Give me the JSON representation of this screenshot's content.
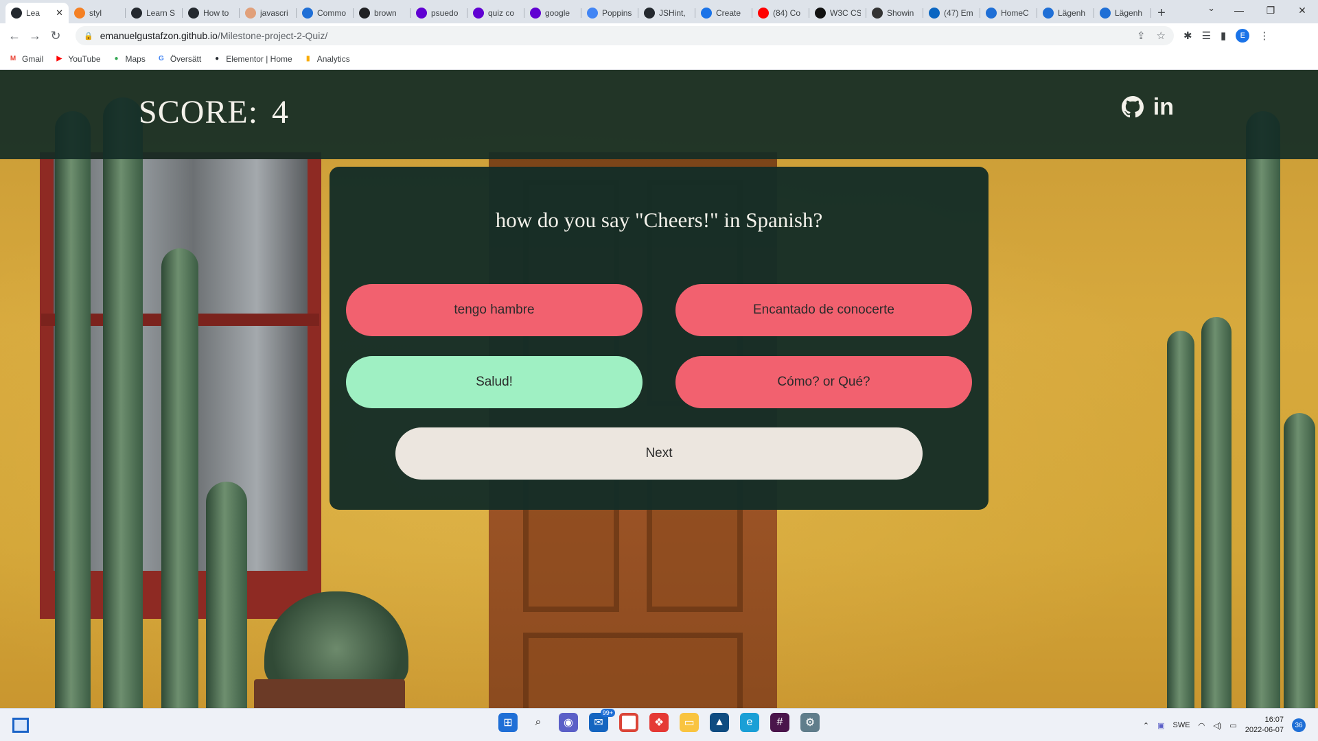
{
  "browser": {
    "tabs": [
      {
        "label": "Lea",
        "icon": "github-icon",
        "color": "#24292f",
        "active": true
      },
      {
        "label": "styl",
        "icon": "stackoverflow-icon",
        "color": "#f48024"
      },
      {
        "label": "Learn S",
        "icon": "github-icon",
        "color": "#24292f"
      },
      {
        "label": "How to",
        "icon": "github-icon",
        "color": "#24292f"
      },
      {
        "label": "javascri",
        "icon": "js-icon",
        "color": "#e1a07a"
      },
      {
        "label": "Commo",
        "icon": "chat-icon",
        "color": "#1f6fd6"
      },
      {
        "label": "brown",
        "icon": "bag-icon",
        "color": "#202124"
      },
      {
        "label": "psuedo",
        "icon": "yahoo-icon",
        "color": "#6001d2"
      },
      {
        "label": "quiz co",
        "icon": "yahoo-icon",
        "color": "#6001d2"
      },
      {
        "label": "google",
        "icon": "yahoo-icon",
        "color": "#6001d2"
      },
      {
        "label": "Poppins",
        "icon": "font-icon",
        "color": "#4285f4"
      },
      {
        "label": "JSHint,",
        "icon": "github-icon",
        "color": "#24292f"
      },
      {
        "label": "Create",
        "icon": "chrome-icon",
        "color": "#1a73e8"
      },
      {
        "label": "(84) Co",
        "icon": "youtube-icon",
        "color": "#ff0000"
      },
      {
        "label": "W3C CS",
        "icon": "w3c-icon",
        "color": "#111111"
      },
      {
        "label": "Showin",
        "icon": "scratch-icon",
        "color": "#333333"
      },
      {
        "label": "(47) Em",
        "icon": "linkedin-icon",
        "color": "#0a66c2"
      },
      {
        "label": "HomeC",
        "icon": "q-icon",
        "color": "#1f6fd6"
      },
      {
        "label": "Lägenh",
        "icon": "q-icon",
        "color": "#1f6fd6"
      },
      {
        "label": "Lägenh",
        "icon": "q-icon",
        "color": "#1f6fd6"
      }
    ],
    "url_host": "emanuelgustafzon.github.io",
    "url_path": "/Milestone-project-2-Quiz/",
    "profile_initial": "E",
    "bookmarks": [
      {
        "label": "Gmail",
        "icon": "gmail-icon",
        "color": "#ea4335",
        "glyph": "M"
      },
      {
        "label": "YouTube",
        "icon": "youtube-icon",
        "color": "#ff0000",
        "glyph": "▶"
      },
      {
        "label": "Maps",
        "icon": "maps-icon",
        "color": "#34a853",
        "glyph": "●"
      },
      {
        "label": "Översätt",
        "icon": "translate-icon",
        "color": "#4285f4",
        "glyph": "G"
      },
      {
        "label": "Elementor | Home",
        "icon": "github-icon",
        "color": "#24292f",
        "glyph": "●"
      },
      {
        "label": "Analytics",
        "icon": "analytics-icon",
        "color": "#f9ab00",
        "glyph": "▮"
      }
    ]
  },
  "page": {
    "score_label": "SCORE:",
    "score_value": "4",
    "question": "how do you say \"Cheers!\" in Spanish?",
    "answers": [
      {
        "label": "tengo hambre",
        "state": "wrong"
      },
      {
        "label": "Encantado de conocerte",
        "state": "wrong"
      },
      {
        "label": "Salud!",
        "state": "right"
      },
      {
        "label": "Cómo? or Qué?",
        "state": "wrong"
      }
    ],
    "next_label": "Next",
    "colors": {
      "header": "#142d26",
      "wrong": "#f2616f",
      "right": "#9ff0c3",
      "next": "#ece6df"
    }
  },
  "taskbar": {
    "mail_badge": "99+",
    "language": "SWE",
    "time": "16:07",
    "date": "2022-06-07",
    "notifications": "36"
  }
}
